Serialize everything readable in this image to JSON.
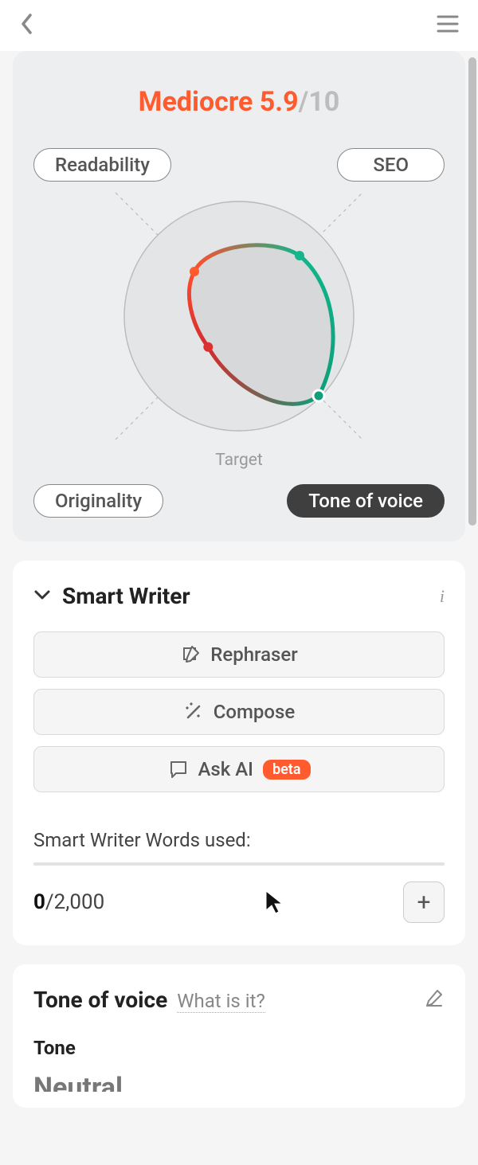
{
  "score": {
    "label": "Mediocre",
    "value": "5.9",
    "max": "/10"
  },
  "chart_data": {
    "type": "radar",
    "axes": [
      "Readability",
      "SEO",
      "Tone of voice",
      "Originality"
    ],
    "values_pct": [
      55,
      75,
      98,
      38
    ],
    "scale": [
      0,
      100
    ],
    "rings": 4,
    "target_label": "Target"
  },
  "pills": {
    "readability": "Readability",
    "seo": "SEO",
    "originality": "Originality",
    "tone": "Tone of voice"
  },
  "smart_writer": {
    "title": "Smart Writer",
    "rephraser": "Rephraser",
    "compose": "Compose",
    "ask_ai": "Ask AI",
    "badge": "beta",
    "usage_label": "Smart Writer Words used:",
    "used": "0",
    "limit": "/2,000"
  },
  "tone_section": {
    "title": "Tone of voice",
    "what": "What is it?",
    "subtitle": "Tone",
    "value": "Neutral"
  }
}
